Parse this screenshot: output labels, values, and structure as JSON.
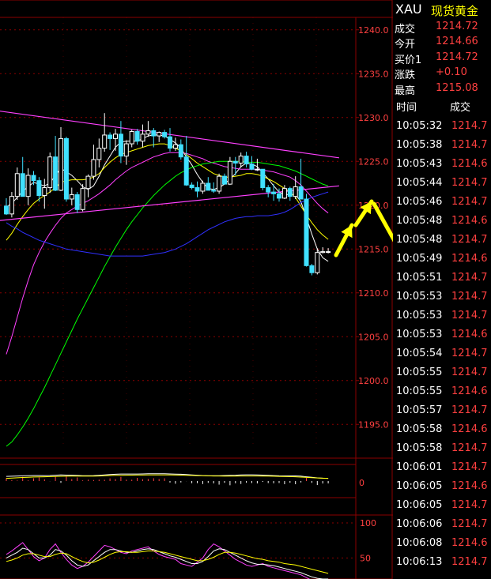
{
  "colors": {
    "background": "#000000",
    "grid": "#8b0000",
    "up_candle": "#ffffff",
    "down_candle": "#40e0ff",
    "text_red": "#ff4040",
    "highlight_yellow": "#ffff00"
  },
  "chart_data": {
    "type": "candlestick",
    "symbol": "XAU",
    "y_axis": {
      "ticks": [
        "1240.0",
        "1235.0",
        "1230.0",
        "1225.0",
        "1220.0",
        "1215.0",
        "1210.0",
        "1205.0",
        "1200.0",
        "1195.0"
      ],
      "range": [
        1192.5,
        1242.5
      ]
    },
    "candles": [
      [
        1219.9,
        1220.8,
        1218.9,
        1219.0
      ],
      [
        1219.0,
        1221.5,
        1218.6,
        1221.0
      ],
      [
        1221.0,
        1224.3,
        1220.6,
        1223.6
      ],
      [
        1223.6,
        1225.5,
        1221.8,
        1221.0
      ],
      [
        1221.0,
        1224.2,
        1220.0,
        1223.4
      ],
      [
        1223.4,
        1223.9,
        1222.3,
        1222.8
      ],
      [
        1222.8,
        1223.2,
        1220.4,
        1221.1
      ],
      [
        1221.1,
        1223.0,
        1219.6,
        1222.0
      ],
      [
        1222.0,
        1226.0,
        1221.4,
        1225.5
      ],
      [
        1225.5,
        1227.9,
        1221.6,
        1221.7
      ],
      [
        1221.7,
        1228.9,
        1221.6,
        1227.6
      ],
      [
        1227.6,
        1227.8,
        1220.4,
        1220.7
      ],
      [
        1220.7,
        1222.0,
        1220.0,
        1221.2
      ],
      [
        1221.2,
        1221.5,
        1219.1,
        1219.5
      ],
      [
        1219.5,
        1222.4,
        1219.3,
        1221.9
      ],
      [
        1221.9,
        1223.5,
        1220.9,
        1223.3
      ],
      [
        1223.3,
        1226.9,
        1222.9,
        1225.2
      ],
      [
        1225.2,
        1227.6,
        1224.3,
        1226.5
      ],
      [
        1226.5,
        1230.5,
        1226.1,
        1228.0
      ],
      [
        1228.0,
        1228.3,
        1226.3,
        1227.6
      ],
      [
        1227.6,
        1228.7,
        1226.2,
        1228.1
      ],
      [
        1228.1,
        1229.6,
        1224.8,
        1225.6
      ],
      [
        1225.6,
        1227.4,
        1224.6,
        1227.0
      ],
      [
        1227.0,
        1228.6,
        1226.6,
        1228.4
      ],
      [
        1228.4,
        1228.7,
        1226.9,
        1227.3
      ],
      [
        1227.3,
        1229.2,
        1226.6,
        1228.1
      ],
      [
        1228.1,
        1229.6,
        1227.8,
        1228.5
      ],
      [
        1228.5,
        1228.8,
        1226.6,
        1227.9
      ],
      [
        1227.9,
        1228.4,
        1227.2,
        1228.3
      ],
      [
        1228.3,
        1228.6,
        1227.6,
        1227.8
      ],
      [
        1227.8,
        1228.8,
        1226.1,
        1226.5
      ],
      [
        1226.5,
        1227.7,
        1226.2,
        1226.9
      ],
      [
        1226.9,
        1227.5,
        1225.2,
        1225.5
      ],
      [
        1225.5,
        1227.9,
        1222.2,
        1222.3
      ],
      [
        1222.3,
        1222.6,
        1221.8,
        1222.0
      ],
      [
        1222.0,
        1222.7,
        1220.9,
        1221.6
      ],
      [
        1221.6,
        1222.8,
        1221.3,
        1222.5
      ],
      [
        1222.5,
        1223.2,
        1221.7,
        1221.7
      ],
      [
        1221.7,
        1222.6,
        1221.4,
        1221.6
      ],
      [
        1221.6,
        1223.6,
        1221.3,
        1223.3
      ],
      [
        1223.3,
        1223.6,
        1222.4,
        1222.4
      ],
      [
        1222.4,
        1225.5,
        1222.3,
        1225.0
      ],
      [
        1225.0,
        1225.5,
        1223.4,
        1224.8
      ],
      [
        1224.8,
        1226.0,
        1224.3,
        1225.6
      ],
      [
        1225.6,
        1226.1,
        1224.3,
        1224.7
      ],
      [
        1224.7,
        1225.6,
        1224.0,
        1224.1
      ],
      [
        1224.1,
        1225.3,
        1223.9,
        1224.1
      ],
      [
        1224.1,
        1224.1,
        1221.7,
        1222.0
      ],
      [
        1222.0,
        1222.3,
        1220.9,
        1221.5
      ],
      [
        1221.5,
        1222.4,
        1220.5,
        1221.3
      ],
      [
        1221.3,
        1221.9,
        1220.4,
        1220.8
      ],
      [
        1220.8,
        1222.3,
        1220.7,
        1221.9
      ],
      [
        1221.9,
        1222.1,
        1220.5,
        1221.0
      ],
      [
        1221.0,
        1223.3,
        1220.7,
        1222.1
      ],
      [
        1222.1,
        1225.3,
        1222.0,
        1220.7
      ],
      [
        1220.7,
        1221.3,
        1213.0,
        1213.1
      ],
      [
        1213.1,
        1213.3,
        1212.0,
        1212.3
      ],
      [
        1212.3,
        1215.1,
        1212.1,
        1214.6
      ],
      [
        1214.6,
        1215.2,
        1214.5,
        1214.7
      ],
      [
        1214.7,
        1215.1,
        1214.5,
        1214.7
      ]
    ],
    "moving_averages": [
      {
        "color": "#ffffff",
        "values": [
          1219.8,
          1220.2,
          1220.9,
          1221.6,
          1222.1,
          1222.6,
          1222.4,
          1222.2,
          1222.5,
          1223.4,
          1224.2,
          1223.8,
          1223.4,
          1222.8,
          1222.1,
          1221.8,
          1222.2,
          1223.3,
          1224.6,
          1225.6,
          1226.6,
          1227.2,
          1227.3,
          1227.3,
          1227.3,
          1227.6,
          1227.9,
          1228.0,
          1228.0,
          1227.9,
          1227.5,
          1227.1,
          1226.5,
          1225.5,
          1224.6,
          1223.5,
          1222.6,
          1221.9,
          1221.8,
          1222.0,
          1222.4,
          1223.0,
          1223.6,
          1224.4,
          1224.8,
          1224.7,
          1224.4,
          1223.7,
          1223.0,
          1222.2,
          1221.5,
          1221.2,
          1221.2,
          1221.2,
          1220.4,
          1218.6,
          1216.7,
          1215.0,
          1214.0,
          1213.6
        ]
      },
      {
        "color": "#ffff00",
        "values": [
          1216.0,
          1216.8,
          1217.8,
          1218.7,
          1219.5,
          1220.2,
          1220.7,
          1221.1,
          1221.5,
          1222.0,
          1222.6,
          1222.8,
          1222.9,
          1222.9,
          1222.9,
          1223.0,
          1223.2,
          1223.6,
          1224.3,
          1224.9,
          1225.4,
          1225.8,
          1226.0,
          1226.2,
          1226.4,
          1226.6,
          1226.8,
          1226.9,
          1227.0,
          1227.0,
          1226.8,
          1226.5,
          1226.2,
          1225.8,
          1225.3,
          1224.8,
          1224.4,
          1224.0,
          1223.6,
          1223.4,
          1223.2,
          1223.2,
          1223.3,
          1223.4,
          1223.6,
          1223.6,
          1223.5,
          1223.3,
          1223.0,
          1222.7,
          1222.3,
          1221.9,
          1221.5,
          1220.9,
          1219.9,
          1218.9,
          1218.0,
          1217.2,
          1216.6,
          1216.1
        ]
      },
      {
        "color": "#ff40ff",
        "values": [
          1203.0,
          1205.0,
          1207.2,
          1209.4,
          1211.4,
          1213.2,
          1214.6,
          1215.8,
          1216.8,
          1217.7,
          1218.5,
          1219.1,
          1219.5,
          1219.9,
          1220.2,
          1220.5,
          1220.9,
          1221.3,
          1221.8,
          1222.3,
          1222.9,
          1223.4,
          1223.9,
          1224.3,
          1224.6,
          1224.9,
          1225.2,
          1225.5,
          1225.7,
          1225.9,
          1226.0,
          1226.0,
          1226.0,
          1225.9,
          1225.7,
          1225.5,
          1225.3,
          1225.0,
          1224.8,
          1224.6,
          1224.4,
          1224.3,
          1224.2,
          1224.1,
          1224.1,
          1224.1,
          1224.1,
          1224.0,
          1223.9,
          1223.8,
          1223.6,
          1223.4,
          1223.2,
          1222.8,
          1222.3,
          1221.6,
          1220.9,
          1220.2,
          1219.6,
          1219.1
        ]
      },
      {
        "color": "#00ff00",
        "values": [
          1192.5,
          1193.0,
          1193.8,
          1194.7,
          1195.7,
          1196.8,
          1198.0,
          1199.2,
          1200.5,
          1201.8,
          1203.1,
          1204.4,
          1205.7,
          1207.0,
          1208.2,
          1209.4,
          1210.6,
          1211.8,
          1213.0,
          1214.1,
          1215.2,
          1216.2,
          1217.2,
          1218.1,
          1218.9,
          1219.7,
          1220.4,
          1221.1,
          1221.7,
          1222.3,
          1222.8,
          1223.3,
          1223.7,
          1224.0,
          1224.3,
          1224.5,
          1224.7,
          1224.8,
          1224.9,
          1225.0,
          1225.0,
          1225.0,
          1225.0,
          1225.0,
          1224.9,
          1224.9,
          1224.9,
          1224.8,
          1224.7,
          1224.6,
          1224.5,
          1224.3,
          1224.1,
          1223.9,
          1223.6,
          1223.3,
          1223.0,
          1222.7,
          1222.4,
          1222.2
        ]
      },
      {
        "color": "#3030ff",
        "values": [
          1218.0,
          1217.6,
          1217.3,
          1216.9,
          1216.6,
          1216.3,
          1216.0,
          1215.8,
          1215.6,
          1215.4,
          1215.2,
          1215.0,
          1214.9,
          1214.8,
          1214.7,
          1214.6,
          1214.5,
          1214.4,
          1214.3,
          1214.2,
          1214.2,
          1214.2,
          1214.2,
          1214.2,
          1214.2,
          1214.2,
          1214.3,
          1214.4,
          1214.5,
          1214.6,
          1214.8,
          1215.0,
          1215.3,
          1215.6,
          1216.0,
          1216.4,
          1216.8,
          1217.2,
          1217.5,
          1217.8,
          1218.1,
          1218.3,
          1218.5,
          1218.6,
          1218.7,
          1218.7,
          1218.8,
          1218.8,
          1218.8,
          1218.9,
          1219.0,
          1219.2,
          1219.5,
          1219.9,
          1220.3,
          1220.6,
          1220.9,
          1221.1,
          1221.3,
          1221.5
        ]
      }
    ],
    "trendlines": [
      {
        "color": "#ff40ff",
        "from": [
          -2,
          1230.8
        ],
        "to": [
          61,
          1225.4
        ]
      },
      {
        "color": "#ff40ff",
        "from": [
          -2,
          1218.2
        ],
        "to": [
          61,
          1222.2
        ]
      }
    ],
    "sub1_label": "0",
    "sub2_ticks": [
      "100",
      "50"
    ],
    "sub2_lines": [
      {
        "color": "#ff40ff",
        "values": [
          55,
          60,
          66,
          72,
          62,
          52,
          46,
          50,
          62,
          70,
          58,
          48,
          40,
          35,
          38,
          44,
          52,
          60,
          68,
          66,
          62,
          58,
          56,
          60,
          62,
          64,
          66,
          60,
          55,
          52,
          50,
          48,
          42,
          40,
          38,
          44,
          50,
          62,
          70,
          66,
          60,
          54,
          48,
          44,
          40,
          38,
          40,
          42,
          38,
          36,
          34,
          32,
          30,
          28,
          26,
          22,
          18,
          16,
          18,
          20
        ]
      },
      {
        "color": "#ffffff",
        "values": [
          50,
          54,
          58,
          64,
          62,
          56,
          50,
          50,
          54,
          62,
          60,
          54,
          46,
          40,
          38,
          40,
          46,
          52,
          58,
          62,
          62,
          60,
          58,
          58,
          60,
          62,
          63,
          62,
          59,
          56,
          53,
          51,
          48,
          45,
          42,
          42,
          45,
          52,
          60,
          63,
          62,
          58,
          54,
          50,
          46,
          43,
          41,
          41,
          40,
          39,
          37,
          35,
          33,
          31,
          29,
          26,
          23,
          21,
          20,
          20
        ]
      },
      {
        "color": "#ffff00",
        "values": [
          45,
          47,
          50,
          54,
          56,
          56,
          54,
          52,
          52,
          55,
          57,
          56,
          52,
          48,
          45,
          43,
          44,
          47,
          51,
          55,
          58,
          59,
          59,
          58,
          58,
          59,
          60,
          60,
          59,
          58,
          56,
          54,
          52,
          50,
          48,
          46,
          46,
          48,
          51,
          55,
          58,
          58,
          57,
          55,
          53,
          51,
          49,
          48,
          46,
          45,
          44,
          42,
          41,
          40,
          38,
          36,
          34,
          32,
          30,
          28
        ]
      }
    ],
    "annotations": {
      "arrow_color": "#ffff00"
    }
  },
  "quote": {
    "symbol": "XAU",
    "name": "现货黄金",
    "rows": [
      {
        "label": "成交",
        "value": "1214.72"
      },
      {
        "label": "今开",
        "value": "1214.66"
      },
      {
        "label": "买价1",
        "value": "1214.72"
      },
      {
        "label": "涨跌",
        "value": "+0.10"
      },
      {
        "label": "最高",
        "value": "1215.08"
      }
    ]
  },
  "ticks": {
    "header_time": "时间",
    "header_price": "成交",
    "rows": [
      {
        "time": "10:05:32",
        "price": "1214.7"
      },
      {
        "time": "10:05:38",
        "price": "1214.7"
      },
      {
        "time": "10:05:43",
        "price": "1214.6"
      },
      {
        "time": "10:05:44",
        "price": "1214.7"
      },
      {
        "time": "10:05:46",
        "price": "1214.7"
      },
      {
        "time": "10:05:48",
        "price": "1214.6"
      },
      {
        "time": "10:05:48",
        "price": "1214.7"
      },
      {
        "time": "10:05:49",
        "price": "1214.6"
      },
      {
        "time": "10:05:51",
        "price": "1214.7"
      },
      {
        "time": "10:05:53",
        "price": "1214.7"
      },
      {
        "time": "10:05:53",
        "price": "1214.7"
      },
      {
        "time": "10:05:53",
        "price": "1214.6"
      },
      {
        "time": "10:05:54",
        "price": "1214.7"
      },
      {
        "time": "10:05:55",
        "price": "1214.7"
      },
      {
        "time": "10:05:55",
        "price": "1214.6"
      },
      {
        "time": "10:05:57",
        "price": "1214.7"
      },
      {
        "time": "10:05:58",
        "price": "1214.6"
      },
      {
        "time": "10:05:58",
        "price": "1214.7"
      },
      {
        "time": "10:06:01",
        "price": "1214.7"
      },
      {
        "time": "10:06:05",
        "price": "1214.6"
      },
      {
        "time": "10:06:05",
        "price": "1214.7"
      },
      {
        "time": "10:06:06",
        "price": "1214.7"
      },
      {
        "time": "10:06:08",
        "price": "1214.6"
      },
      {
        "time": "10:06:13",
        "price": "1214.7"
      }
    ]
  }
}
